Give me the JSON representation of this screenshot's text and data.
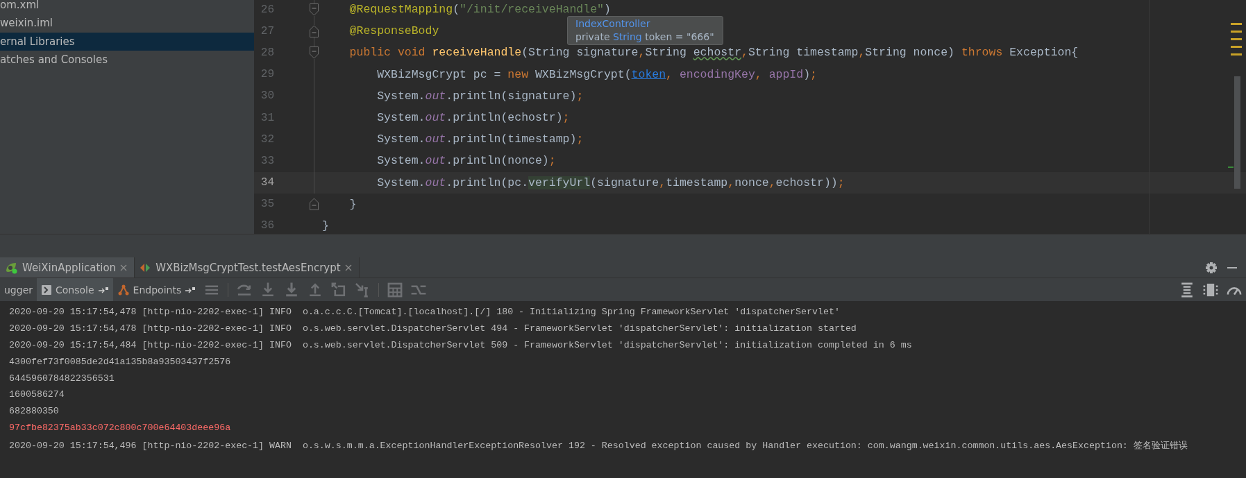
{
  "project_tree": {
    "items": [
      {
        "label": "om.xml",
        "selected": false
      },
      {
        "label": "weixin.iml",
        "selected": false
      },
      {
        "label": "ernal Libraries",
        "selected": true
      },
      {
        "label": "atches and Consoles",
        "selected": false
      }
    ]
  },
  "editor": {
    "lines": [
      {
        "number": "26",
        "current": false,
        "fold": {
          "kind": "open"
        },
        "tokens": [
          {
            "text": "    @RequestMapping",
            "kind": "annotation"
          },
          {
            "text": "(",
            "kind": "plain"
          },
          {
            "text": "\"/init/receiveHandle\"",
            "kind": "string"
          },
          {
            "text": ")",
            "kind": "plain"
          }
        ]
      },
      {
        "number": "27",
        "current": false,
        "fold": {
          "kind": "close"
        },
        "tokens": [
          {
            "text": "    @ResponseBody",
            "kind": "annotation"
          }
        ]
      },
      {
        "number": "28",
        "current": false,
        "fold": {
          "kind": "open"
        },
        "tokens": [
          {
            "text": "    public void ",
            "kind": "keyword"
          },
          {
            "text": "receiveHandle",
            "kind": "method"
          },
          {
            "text": "(String signature",
            "kind": "plain"
          },
          {
            "text": ",",
            "kind": "punct"
          },
          {
            "text": "String ",
            "kind": "plain"
          },
          {
            "text": "echostr",
            "kind": "typo"
          },
          {
            "text": ",",
            "kind": "punct"
          },
          {
            "text": "String timestamp",
            "kind": "plain"
          },
          {
            "text": ",",
            "kind": "punct"
          },
          {
            "text": "String nonce) ",
            "kind": "plain"
          },
          {
            "text": "throws ",
            "kind": "keyword"
          },
          {
            "text": "Exception{",
            "kind": "plain"
          }
        ]
      },
      {
        "number": "29",
        "current": false,
        "tokens": [
          {
            "text": "        WXBizMsgCrypt pc = ",
            "kind": "plain"
          },
          {
            "text": "new ",
            "kind": "keyword"
          },
          {
            "text": "WXBizMsgCrypt(",
            "kind": "plain"
          },
          {
            "text": "token",
            "kind": "link"
          },
          {
            "text": ", ",
            "kind": "punct"
          },
          {
            "text": "encodingKey",
            "kind": "field"
          },
          {
            "text": ", ",
            "kind": "punct"
          },
          {
            "text": "appId",
            "kind": "field"
          },
          {
            "text": ")",
            "kind": "plain"
          },
          {
            "text": ";",
            "kind": "punct"
          }
        ]
      },
      {
        "number": "30",
        "current": false,
        "tokens": [
          {
            "text": "        System.",
            "kind": "plain"
          },
          {
            "text": "out",
            "kind": "static"
          },
          {
            "text": ".println(signature)",
            "kind": "plain"
          },
          {
            "text": ";",
            "kind": "punct"
          }
        ]
      },
      {
        "number": "31",
        "current": false,
        "tokens": [
          {
            "text": "        System.",
            "kind": "plain"
          },
          {
            "text": "out",
            "kind": "static"
          },
          {
            "text": ".println(echostr)",
            "kind": "plain"
          },
          {
            "text": ";",
            "kind": "punct"
          }
        ]
      },
      {
        "number": "32",
        "current": false,
        "tokens": [
          {
            "text": "        System.",
            "kind": "plain"
          },
          {
            "text": "out",
            "kind": "static"
          },
          {
            "text": ".println(timestamp)",
            "kind": "plain"
          },
          {
            "text": ";",
            "kind": "punct"
          }
        ]
      },
      {
        "number": "33",
        "current": false,
        "tokens": [
          {
            "text": "        System.",
            "kind": "plain"
          },
          {
            "text": "out",
            "kind": "static"
          },
          {
            "text": ".println(nonce)",
            "kind": "plain"
          },
          {
            "text": ";",
            "kind": "punct"
          }
        ]
      },
      {
        "number": "34",
        "current": true,
        "tokens": [
          {
            "text": "        System.",
            "kind": "plain"
          },
          {
            "text": "out",
            "kind": "static"
          },
          {
            "text": ".println(pc.",
            "kind": "plain"
          },
          {
            "text": "verifyUrl",
            "kind": "usage"
          },
          {
            "text": "(signature",
            "kind": "plain"
          },
          {
            "text": ",",
            "kind": "punct"
          },
          {
            "text": "timestamp",
            "kind": "plain"
          },
          {
            "text": ",",
            "kind": "punct"
          },
          {
            "text": "nonce",
            "kind": "plain"
          },
          {
            "text": ",",
            "kind": "punct"
          },
          {
            "text": "echostr))",
            "kind": "plain"
          },
          {
            "text": ";",
            "kind": "punct"
          }
        ]
      },
      {
        "number": "35",
        "current": false,
        "fold": {
          "kind": "close"
        },
        "tokens": [
          {
            "text": "    }",
            "kind": "plain"
          }
        ]
      },
      {
        "number": "36",
        "current": false,
        "tokens": [
          {
            "text": "}",
            "kind": "plain"
          }
        ]
      }
    ],
    "tooltip": {
      "title": "IndexController",
      "parts": [
        {
          "text": "private ",
          "kind": "plain"
        },
        {
          "text": "String",
          "kind": "type"
        },
        {
          "text": " token = \"666\"",
          "kind": "plain"
        }
      ]
    }
  },
  "run_tabs": [
    {
      "label": "WeiXinApplication",
      "kind": "spring",
      "selected": true
    },
    {
      "label": "WXBizMsgCryptTest.testAesEncrypt",
      "kind": "test",
      "selected": false
    }
  ],
  "toolbar_tabs": [
    {
      "label": "ugger",
      "kind": "debugger",
      "selected": false
    },
    {
      "label": "Console",
      "kind": "console",
      "selected": true
    },
    {
      "label": "Endpoints",
      "kind": "endpoints",
      "selected": false
    }
  ],
  "console": {
    "lines": [
      {
        "text": "2020-09-20 15:17:54,478 [http-nio-2202-exec-1] INFO  o.a.c.c.C.[Tomcat].[localhost].[/] 180 - Initializing Spring FrameworkServlet 'dispatcherServlet'",
        "kind": "stdout"
      },
      {
        "text": "2020-09-20 15:17:54,478 [http-nio-2202-exec-1] INFO  o.s.web.servlet.DispatcherServlet 494 - FrameworkServlet 'dispatcherServlet': initialization started",
        "kind": "stdout"
      },
      {
        "text": "2020-09-20 15:17:54,484 [http-nio-2202-exec-1] INFO  o.s.web.servlet.DispatcherServlet 509 - FrameworkServlet 'dispatcherServlet': initialization completed in 6 ms",
        "kind": "stdout"
      },
      {
        "text": "4300fef73f0085de2d41a135b8a93503437f2576",
        "kind": "stdout"
      },
      {
        "text": "6445960784822356531",
        "kind": "stdout"
      },
      {
        "text": "1600586274",
        "kind": "stdout"
      },
      {
        "text": "682880350",
        "kind": "stdout"
      },
      {
        "text": "97cfbe82375ab33c072c800c700e64403deee96a",
        "kind": "stderr"
      },
      {
        "text": "2020-09-20 15:17:54,496 [http-nio-2202-exec-1] WARN  o.s.w.s.m.m.a.ExceptionHandlerExceptionResolver 192 - Resolved exception caused by Handler execution: com.wangm.weixin.common.utils.aes.AesException: 签名验证错误",
        "kind": "stdout"
      }
    ]
  }
}
